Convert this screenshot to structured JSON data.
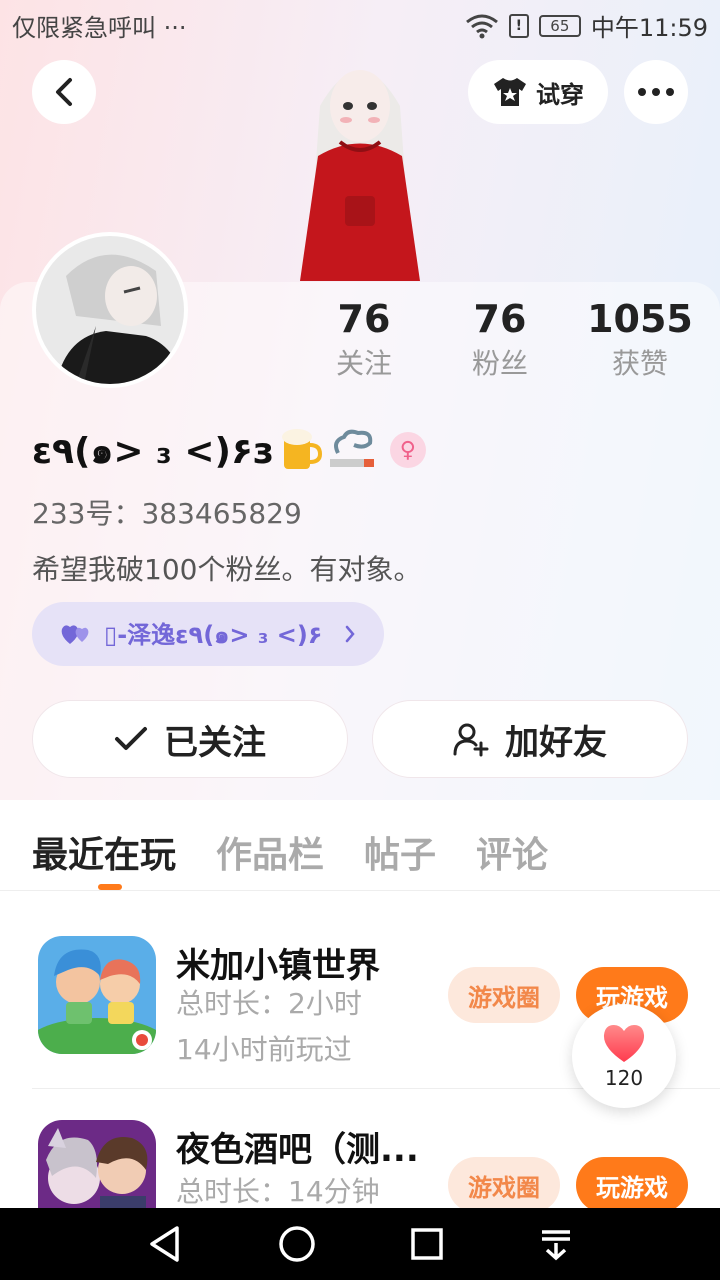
{
  "status_bar": {
    "carrier_text": "仅限紧急呼叫 ···",
    "battery": "65",
    "time": "中午11:59"
  },
  "header": {
    "tryon_label": "试穿"
  },
  "stats": [
    {
      "value": "76",
      "label": "关注"
    },
    {
      "value": "76",
      "label": "粉丝"
    },
    {
      "value": "1055",
      "label": "获赞"
    }
  ],
  "profile": {
    "nickname": "ε٩(๑> ₃ <)۶з",
    "gender_symbol": "♀",
    "id_text": "233号：383465829",
    "bio": "希望我破100个粉丝。有对象。",
    "fan_pill": "▯-泽逸ε٩(๑> ₃ <)۶"
  },
  "actions": {
    "follow_label": "已关注",
    "add_friend_label": "加好友"
  },
  "tabs": [
    "最近在玩",
    "作品栏",
    "帖子",
    "评论"
  ],
  "games": [
    {
      "name": "米加小镇世界",
      "duration": "总时长：2小时",
      "last_played": "14小时前玩过",
      "circle_label": "游戏圈",
      "play_label": "玩游戏"
    },
    {
      "name": "夜色酒吧（测...",
      "duration": "总时长：14分钟",
      "circle_label": "游戏圈",
      "play_label": "玩游戏"
    }
  ],
  "like_fab": {
    "count": "120"
  },
  "colors": {
    "accent": "#ff7a1a",
    "pill_bg": "#fde8dc",
    "fan_pill_text": "#7367d8"
  },
  "icons": [
    "back-arrow-icon",
    "tshirt-icon",
    "more-dots-icon",
    "check-icon",
    "add-user-icon",
    "heart-icon",
    "wifi-icon",
    "nav-back-icon",
    "nav-home-icon",
    "nav-recents-icon",
    "nav-menu-icon"
  ]
}
